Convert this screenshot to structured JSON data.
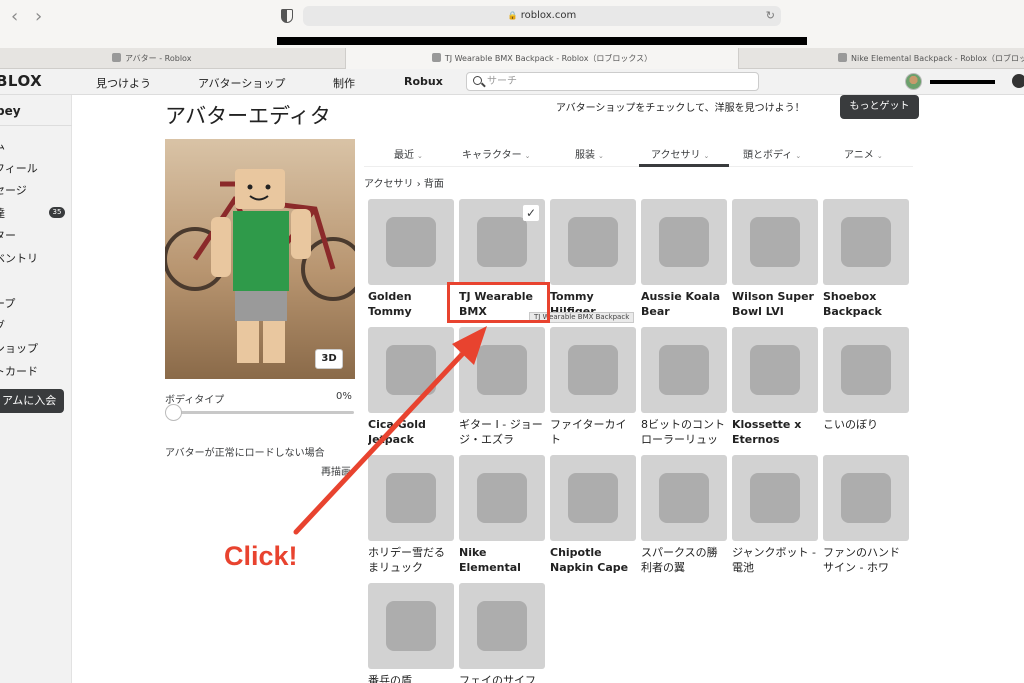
{
  "browser": {
    "url": "roblox.com",
    "tabs": [
      "アバター - Roblox",
      "TJ Wearable BMX Backpack - Roblox（ロブロックス）",
      "Nike Elemental Backpack - Roblox（ロブロックス）"
    ]
  },
  "header": {
    "logo": "BLOX",
    "nav": [
      "見つけよう",
      "アバターショップ",
      "制作",
      "Robux"
    ],
    "search_placeholder": "サーチ"
  },
  "sidebar": {
    "username": "bey",
    "items": [
      "ム",
      "フィール",
      "セージ",
      "達",
      "ター",
      "ベントリ",
      "|",
      "ープ",
      "グ",
      "ショップ",
      "トカード"
    ],
    "friends_badge": "35",
    "premium": "アムに入会"
  },
  "main": {
    "title": "アバターエディタ",
    "promo": "アバターショップをチェックして、洋服を見つけよう！",
    "get_more": "もっとゲット",
    "btn_3d": "3D",
    "bodytype_label": "ボディタイプ",
    "bodytype_value": "0%",
    "not_loading": "アバターが正常にロードしない場合",
    "redraw": "再描画",
    "category_tabs": [
      "最近",
      "キャラクター",
      "服装",
      "アクセサリ",
      "頭とボディ",
      "アニメ"
    ],
    "active_tab": "アクセサリ",
    "breadcrumb": [
      "アクセサリ",
      "背面"
    ],
    "items": [
      {
        "name": "Golden Tommy",
        "icon": "golden-tommy-icon",
        "jp": false
      },
      {
        "name": "TJ Wearable BMX",
        "icon": "bmx-bike-icon",
        "jp": false,
        "selected": true
      },
      {
        "name": "Tommy Hilfiger",
        "icon": "tommy-flag-icon",
        "jp": false
      },
      {
        "name": "Aussie Koala Bear",
        "icon": "koala-backpack-icon",
        "jp": false
      },
      {
        "name": "Wilson Super Bowl LVI",
        "icon": "football-icon",
        "jp": false
      },
      {
        "name": "Shoebox Backpack",
        "icon": "shoebox-icon",
        "jp": false
      },
      {
        "name": "Cica Gold Jetpack",
        "icon": "jetpack-icon",
        "jp": false
      },
      {
        "name": "ギター I - ジョージ・エズラ",
        "icon": "guitar-icon",
        "jp": true
      },
      {
        "name": "ファイターカイト",
        "icon": "kite-icon",
        "jp": true
      },
      {
        "name": "8ビットのコントローラーリュッ",
        "icon": "controller-icon",
        "jp": true
      },
      {
        "name": "Klossette x Eternos",
        "icon": "black-backpack-icon",
        "jp": false
      },
      {
        "name": "こいのぼり",
        "icon": "koinobori-icon",
        "jp": true
      },
      {
        "name": "ホリデー雪だるまリュック",
        "icon": "snowman-icon",
        "jp": true
      },
      {
        "name": "Nike Elemental",
        "icon": "nike-backpack-icon",
        "jp": false
      },
      {
        "name": "Chipotle Napkin Cape",
        "icon": "napkin-cape-icon",
        "jp": false
      },
      {
        "name": "スパークスの勝利者の翼",
        "icon": "wings-icon",
        "jp": true
      },
      {
        "name": "ジャンクボット - 電池",
        "icon": "battery-icon",
        "jp": true
      },
      {
        "name": "ファンのハンドサイン - ホワ",
        "icon": "foam-hand-icon",
        "jp": true
      },
      {
        "name": "番兵の盾",
        "icon": "shield-icon",
        "jp": true
      },
      {
        "name": "フェイのサイフ",
        "icon": "sword-icon",
        "jp": true
      }
    ],
    "tooltip": "TJ Wearable BMX Backpack"
  },
  "annotation": {
    "label": "Click!",
    "color": "#e8432f"
  }
}
